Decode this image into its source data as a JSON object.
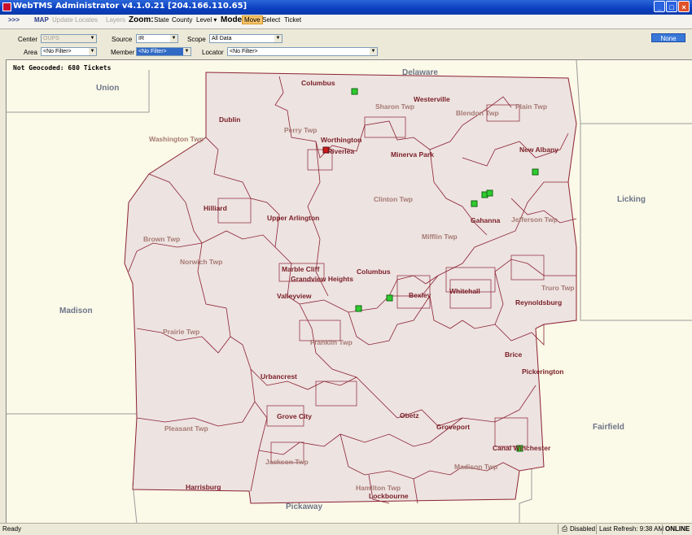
{
  "window": {
    "title": "WebTMS Administrator v4.1.0.21 [204.166.110.65]"
  },
  "toolbar": {
    "expand": ">>>",
    "map": "MAP",
    "update_locates": "Update Locates",
    "layers": "Layers",
    "zoom_label": "Zoom:",
    "zoom_state": "State",
    "zoom_county": "County",
    "zoom_level": "Level ▾",
    "mode_label": "Mode",
    "mode_move": "Move",
    "mode_select": "Select",
    "mode_ticket": "Ticket"
  },
  "filters": {
    "center_label": "Center",
    "center_value": "OUPS",
    "source_label": "Source",
    "source_value": "IR",
    "scope_label": "Scope",
    "scope_value": "All Data",
    "area_label": "Area",
    "area_value": "<No Filter>",
    "member_label": "Member",
    "member_value": "<No Filter>",
    "locator_label": "Locator",
    "locator_value": "<No Filter>",
    "none_button": "None"
  },
  "map": {
    "not_geocoded": "Not Geocoded: 680 Tickets",
    "counties": [
      "Union",
      "Delaware",
      "Licking",
      "Madison",
      "Fairfield",
      "Pickaway"
    ],
    "cities": [
      "Columbus",
      "Westerville",
      "Dublin",
      "Worthington",
      "Riverlea",
      "Minerva Park",
      "New Albany",
      "Hilliard",
      "Upper Arlington",
      "Gahanna",
      "Marble Cliff",
      "Grandview Heights",
      "Columbus",
      "Valleyview",
      "Bexley",
      "Whitehall",
      "Reynoldsburg",
      "Brice",
      "Pickerington",
      "Urbancrest",
      "Grove City",
      "Obetz",
      "Groveport",
      "Canal Winchester",
      "Harrisburg",
      "Lockbourne"
    ],
    "townships": [
      "Sharon Twp",
      "Blendon Twp",
      "Plain Twp",
      "Perry Twp",
      "Washington Twp",
      "Clinton Twp",
      "Jefferson Twp",
      "Mifflin Twp",
      "Brown Twp",
      "Norwich Twp",
      "Truro Twp",
      "Prairie Twp",
      "Franklin Twp",
      "Pleasant Twp",
      "Jackson Twp",
      "Madison Twp",
      "Hamilton Twp"
    ]
  },
  "status": {
    "ready": "Ready",
    "disabled": "Disabled",
    "last_refresh": "Last Refresh: 9:38 AM",
    "online": "ONLINE"
  },
  "colors": {
    "title_bar": "#0a3ec0",
    "map_region": "#ede3e1",
    "boundary": "#8b2232",
    "ticket_marker": "#2ecc2e"
  }
}
